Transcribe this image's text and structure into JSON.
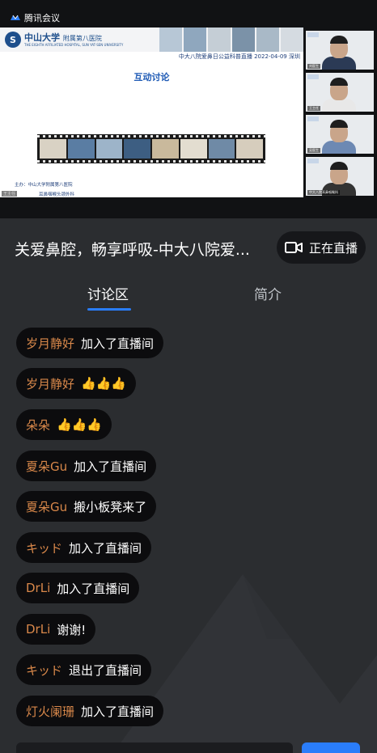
{
  "app": {
    "brand": "腾讯会议"
  },
  "slide": {
    "org_name": "中山大学",
    "org_sub": "附属第八医院",
    "org_en": "THE EIGHTH AFFILIATED HOSPITAL, SUN YAT-SEN UNIVERSITY",
    "subtitle": "中大八院爱鼻日公益科普直播 2022-04-09 深圳",
    "title": "互动讨论",
    "footer_line1": "主办：中山大学附属第八医院",
    "footer_line2": "耳鼻咽喉头颈外科",
    "speaker_tag": "王主任"
  },
  "participants": [
    {
      "name": "刘医生"
    },
    {
      "name": "王主任"
    },
    {
      "name": "吴医生"
    },
    {
      "name": "中大八院耳鼻咽喉科"
    }
  ],
  "live": {
    "title": "关爱鼻腔，畅享呼吸-中大八院爱...",
    "status_label": "正在直播",
    "status_icon": "video-camera-icon"
  },
  "tabs": [
    {
      "label": "讨论区",
      "active": true
    },
    {
      "label": "简介",
      "active": false
    }
  ],
  "messages": [
    {
      "user": "岁月静好",
      "text": "加入了直播间"
    },
    {
      "user": "岁月静好",
      "text": "👍👍👍"
    },
    {
      "user": "朵朵",
      "text": "👍👍👍"
    },
    {
      "user": "夏朵Gu",
      "text": "加入了直播间"
    },
    {
      "user": "夏朵Gu",
      "text": "搬小板凳来了"
    },
    {
      "user": "キッド",
      "text": "加入了直播间"
    },
    {
      "user": "DrLi",
      "text": "加入了直播间"
    },
    {
      "user": "DrLi",
      "text": "谢谢!"
    },
    {
      "user": "キッド",
      "text": "退出了直播间"
    },
    {
      "user": "灯火阑珊",
      "text": "加入了直播间"
    }
  ],
  "colors": {
    "accent": "#2a7dfa",
    "username": "#d9884a",
    "background": "#2b2d30",
    "bubble": "#0c0c0e"
  }
}
